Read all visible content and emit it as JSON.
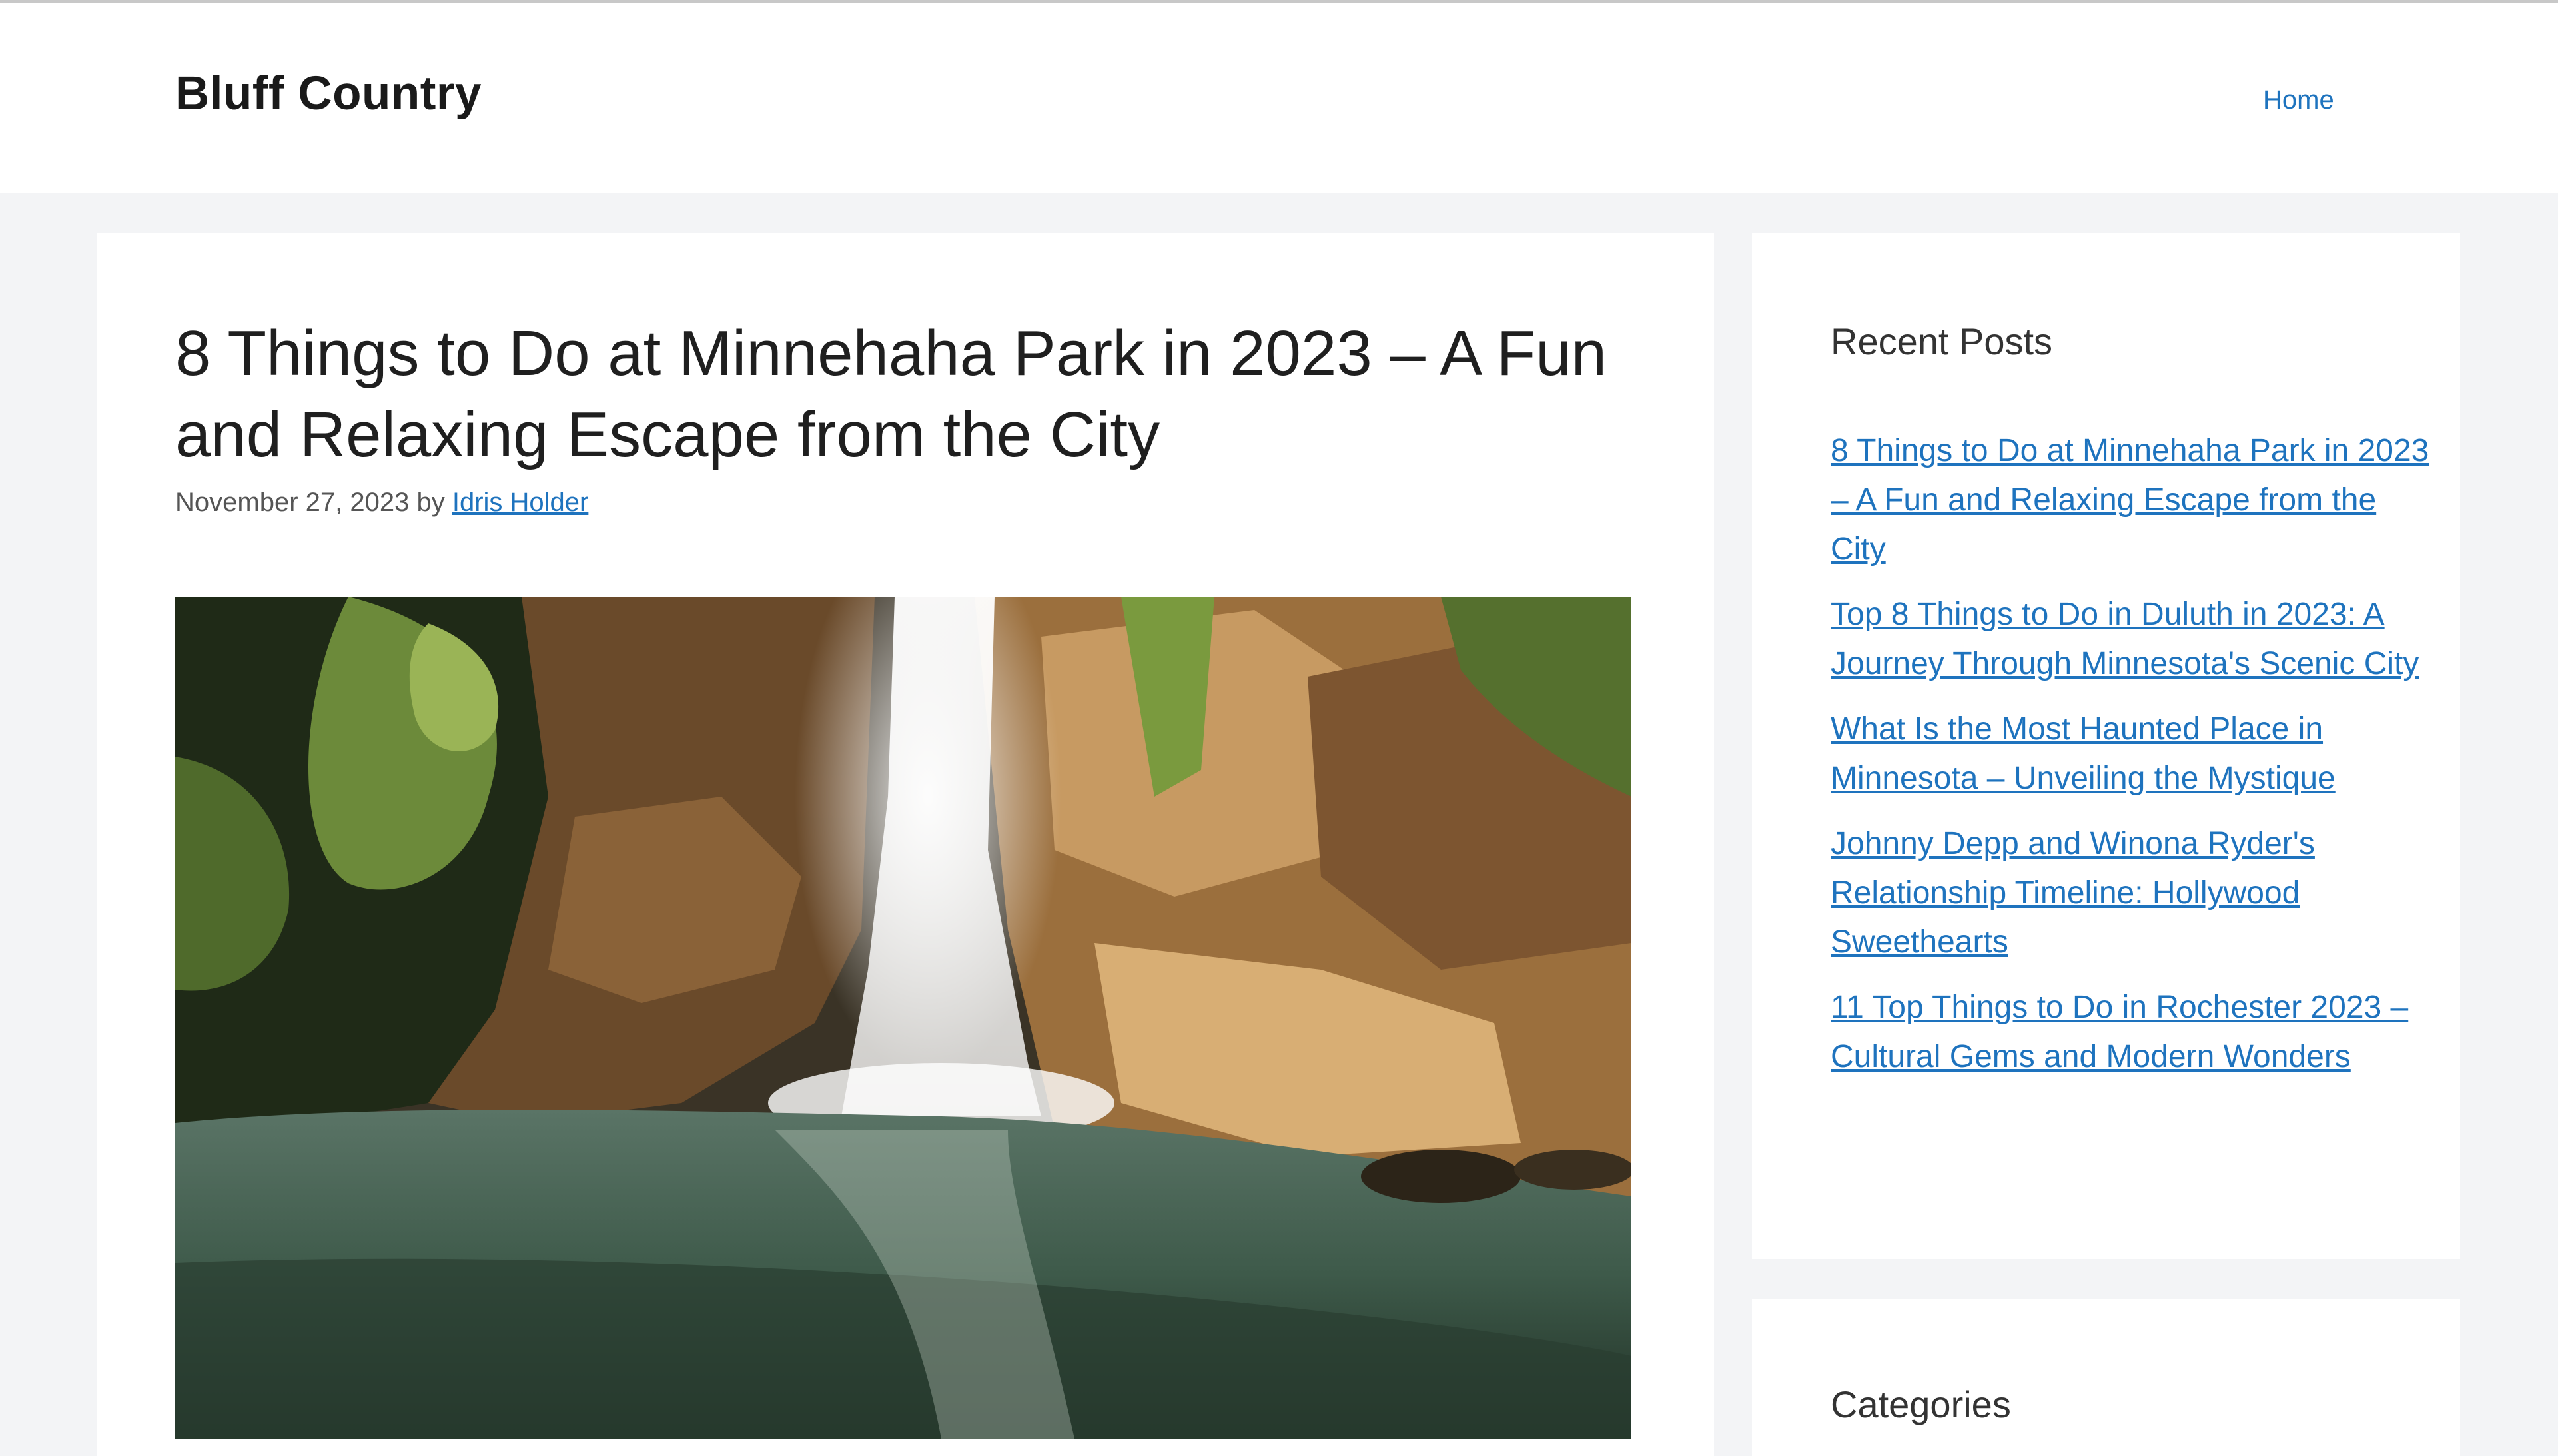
{
  "header": {
    "site_title": "Bluff Country",
    "nav": {
      "home_label": "Home"
    }
  },
  "article": {
    "title": "8 Things to Do at Minnehaha Park in 2023 – A Fun and Relaxing Escape from the City",
    "date": "November 27, 2023",
    "by": "by",
    "author": "Idris Holder",
    "image_icon": "waterfall-photo"
  },
  "sidebar": {
    "recent_posts": {
      "title": "Recent Posts",
      "items": [
        "8 Things to Do at Minnehaha Park in 2023 – A Fun and Relaxing Escape from the City",
        "Top 8 Things to Do in Duluth in 2023: A Journey Through Minnesota's Scenic City",
        "What Is the Most Haunted Place in Minnesota – Unveiling the Mystique",
        "Johnny Depp and Winona Ryder's Relationship Timeline: Hollywood Sweethearts",
        "11 Top Things to Do in Rochester 2023 – Cultural Gems and Modern Wonders"
      ]
    },
    "categories": {
      "title": "Categories"
    }
  },
  "colors": {
    "link": "#1e73be",
    "page_background": "#f3f4f6",
    "card_background": "#ffffff"
  }
}
